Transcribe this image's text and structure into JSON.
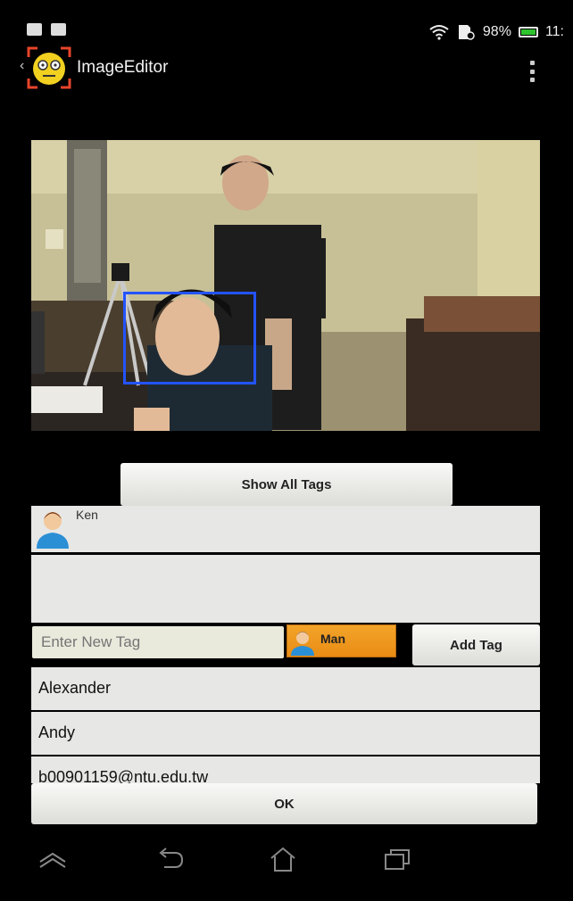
{
  "status_bar": {
    "battery_text": "98%",
    "time_text": "11:"
  },
  "action_bar": {
    "title": "ImageEditor"
  },
  "icons": {
    "status_left": [
      "image-notification-icon",
      "bag-notification-icon"
    ],
    "status_right": [
      "wifi-icon",
      "sd-card-icon",
      "battery-icon"
    ],
    "nav": [
      "nav-up-chevron-icon",
      "back-icon",
      "home-icon",
      "recent-apps-icon"
    ]
  },
  "colors": {
    "face_box": "#2453ff",
    "chip_orange": "#f09a20",
    "battery_green": "#2ec22e"
  },
  "buttons": {
    "show_all_tags": "Show All Tags",
    "add_tag": "Add Tag",
    "ok": "OK"
  },
  "tagged_person": {
    "name": "Ken"
  },
  "tag_input": {
    "placeholder": "Enter New Tag",
    "value": ""
  },
  "gender_chip": {
    "label": "Man"
  },
  "suggestions": [
    "Alexander",
    "Andy",
    "b00901159@ntu.edu.tw"
  ]
}
